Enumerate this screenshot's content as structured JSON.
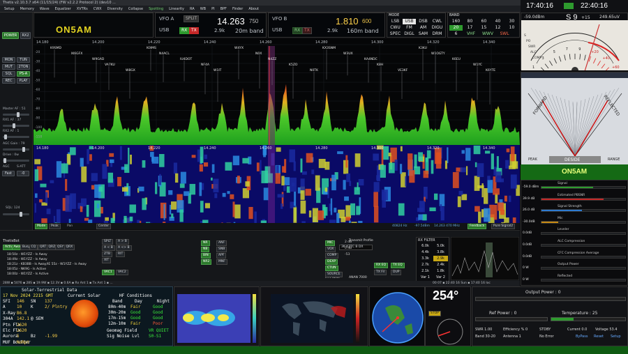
{
  "window": {
    "title": "Thetis v2.10.3.7 x64 (11/15/24) (FW v2.2.2 Protocol 2) (dev10 ...",
    "controls": [
      "—",
      "▢",
      "✕"
    ]
  },
  "menu": [
    "Setup",
    "Memory",
    "Wave",
    "Equalizer",
    "XVTRs",
    "CWX",
    "Diversity",
    "Collapse",
    "Spotting",
    "Linearity",
    "RA",
    "WB",
    "PI",
    "BPF",
    "Finder",
    "About"
  ],
  "menu_active": "Spotting",
  "left": {
    "power": "POWER",
    "rx2": "RX2",
    "buttons": [
      "MON",
      "TUN",
      "MUT",
      "2TON",
      "SQL",
      "PS-A",
      "REC",
      "PLAY"
    ],
    "labels": {
      "master_af": "Master AF : 51",
      "rx1_af": "RX1 AF : 37",
      "rx2_af": "RX2 AF : 1",
      "agc_gain": "AGC Gain : 79",
      "drive": "Drive : 0w",
      "agc": "AGC",
      "s_att": "S-ATT",
      "fast": "Fast",
      "att": "-0",
      "sql": "SQL: 124"
    }
  },
  "vfo": {
    "callsign": "ON5AM",
    "a": {
      "label": "VFO A",
      "split": "SPLIT",
      "mode": "USB",
      "rx": "RX",
      "tx": "TX",
      "bw": "2.9k",
      "freq_main": "14.263",
      "freq_sub": "750",
      "band": "20m band"
    },
    "b": {
      "label": "VFO B",
      "mode": "USB",
      "rx": "RX",
      "tx": "TX",
      "bw": "2.9k",
      "freq_main": "1.810",
      "freq_sub": "600",
      "band": "160m band"
    }
  },
  "mode": {
    "title": "MODE",
    "items": [
      "LSB",
      "USB",
      "DSB",
      "CWL",
      "CWU",
      "FM",
      "AM",
      "DIGU",
      "SPEC",
      "DIGL",
      "SAM",
      "DRM"
    ],
    "selected": "USB"
  },
  "band": {
    "title": "BAND",
    "items": [
      "160",
      "80",
      "60",
      "40",
      "30",
      "20",
      "17",
      "15",
      "12",
      "10",
      "6",
      "VHF",
      "WWV",
      "SWL"
    ],
    "selected": "20"
  },
  "clock": {
    "local": "17:40:16",
    "utc": "22:40:16"
  },
  "smeter": {
    "dbm": "-59.0dBm",
    "reading": "S 9",
    "plus": "+15",
    "uv": "249.65uV",
    "scale": [
      "1",
      "3",
      "5",
      "7",
      "9",
      "+20",
      "+40",
      "+60"
    ],
    "labels": [
      "S",
      "PO",
      "SWR",
      "ALC",
      "COMP"
    ]
  },
  "swrmeter": {
    "forward": "FORWARD",
    "reflected": "REFLECTED",
    "brand": "DESIDE",
    "peak": "PEAK",
    "range": "RANGE"
  },
  "right_call": "ON5AM",
  "meters": [
    {
      "label": "Signal",
      "value": "-59.0 dBm"
    },
    {
      "label": "Estimated PBSNR",
      "value": "39.9 dB"
    },
    {
      "label": "Signal Strength",
      "value": "26.0 dB"
    },
    {
      "label": "Mic",
      "value": "-30.0dB"
    },
    {
      "label": "Leveler",
      "value": "0.0dB"
    },
    {
      "label": "ALC Compression",
      "value": "0.0dB"
    },
    {
      "label": "CFC Compression Average",
      "value": "0.0dB"
    },
    {
      "label": "Output Power",
      "value": "0 W"
    },
    {
      "label": "Reflected",
      "value": "0 W"
    }
  ],
  "spectrum": {
    "freq_ticks": [
      "14.180",
      "14.200",
      "14.220",
      "14.240",
      "14.260",
      "14.280",
      "14.300",
      "14.320",
      "14.340"
    ],
    "spots": [
      "K9SMD",
      "IK6GFX",
      "W9GAD",
      "VA7KU",
      "W8GX",
      "K0IMS",
      "N4ACL",
      "IU4DOT",
      "NF4A",
      "W1IT",
      "W4YX",
      "N0X",
      "N4ZZ",
      "K5ZO",
      "N0TK",
      "KX3SNM",
      "W3UX",
      "KA4NDC",
      "K8H",
      "VE3KF",
      "K3KU",
      "W1OGTY",
      "K6EU",
      "W1YC",
      "K6YTE"
    ],
    "marker": "14.263",
    "db_ticks": [
      "-20",
      "-30",
      "-40",
      "-50",
      "-60",
      "-70",
      "-80",
      "-90",
      "-100",
      "-110",
      "-120"
    ]
  },
  "spec_status": {
    "mode": "Mode",
    "peak": "Peak",
    "pan": "Pan",
    "center": "Center",
    "hz": "40824 Hz",
    "dbm": "-97.5dBm",
    "freq": "14.263 470 MHz",
    "feedback": "Feedback",
    "pure_signal": "Pure Signal2"
  },
  "lower": {
    "thetis_title": "ThetisBot",
    "macros": [
      "Active",
      "Away",
      "Busy",
      "CQ",
      "QRT",
      "QRZ",
      "QSY",
      "QRX"
    ],
    "log": [
      "18:50z - W1YZZ - Is Away",
      "18:49z - W1YZZ - Is Away",
      "18:21z - KB3BB - Is Away/IE 55z - W1YZZ - Is Away",
      "18:05z - NK9G - Is Active",
      "18:00z - W1YZZ - Is Active"
    ],
    "split_buttons": [
      "SPLT",
      "A > B",
      "A < B",
      "A <> B",
      "ZTB",
      "RIT",
      "XIT"
    ],
    "vac": [
      "VAC1",
      "VAC2"
    ],
    "mic_buttons": [
      "MIC",
      "VOX",
      "COMP",
      "DEXP",
      "CTUN",
      "SOURCE"
    ],
    "dsp": [
      "NR",
      "ANF",
      "NB",
      "SNB",
      "BIN",
      "APF",
      "NR2",
      "MNF"
    ],
    "transmit_profile": "Transmit Profile",
    "tx_profile_value": "3K KZTC B DX",
    "eq": [
      "RX EQ",
      "TX EQ",
      "TX Fil",
      "DUP"
    ],
    "pa_profile": "PA Profile",
    "pa_value": "ANAN 7000",
    "mic_vals": [
      "2 dB",
      "0 dB",
      "-53"
    ],
    "rx_filter": {
      "title": "RX FILTER",
      "items": [
        "6.0k",
        "5.0k",
        "4.4k",
        "3.8k",
        "3.3k",
        "2.9k",
        "2.7k",
        "2.4k",
        "2.1k",
        "1.8k",
        "Var 1",
        "Var 2"
      ],
      "selected": "2.9k"
    }
  },
  "statusbar": [
    "28W ▪ 5076 ▪ 28S ▪ 19.9W ▪ 12.3V ▪ 0.6A ▪ Rx Ant 1 ▪ Tx Ant 1 ▪ ...",
    "00 07 ▪ 22:40 16 Sun ▪ 17:40 16 loc"
  ],
  "solar": {
    "title": "Solar-Terrestrial Data",
    "date": "17 Nov 2024 2215 GMT",
    "current": "Current Solar",
    "rows": [
      [
        "SFI",
        "146",
        "SN",
        "137"
      ],
      [
        "A",
        "10",
        "K",
        "2/ Plntry"
      ],
      [
        "X-Ray",
        "B6.8"
      ],
      [
        "304A",
        "142.1",
        "@ SEM"
      ],
      [
        "Ptn Flx",
        "2620"
      ],
      [
        "Elc Flx",
        "2620"
      ],
      [
        "Aurora",
        "5",
        "Bz",
        "-1.99"
      ],
      [
        "MUF Boulder",
        "NoRpt"
      ]
    ],
    "hf_title": "HF Conditions",
    "hf_head": [
      "Band",
      "Day",
      "Night"
    ],
    "hf": [
      [
        "80m-40m",
        "Fair",
        "Good"
      ],
      [
        "30m-20m",
        "Good",
        "Good"
      ],
      [
        "17m-15m",
        "Good",
        "Good"
      ],
      [
        "12m-10m",
        "Fair",
        "Poor"
      ]
    ],
    "geomag": [
      "Geomag Field",
      "VR QUIET"
    ],
    "noise": [
      "Sig Noise Lvl",
      "S0-S1"
    ]
  },
  "rotor": {
    "heading": "254°",
    "btn": "STOP"
  },
  "amp": {
    "output_power": "Output Power : 0",
    "ref_power": "Ref Power : 0",
    "temperature": "Temperature : 25",
    "swr": "SWR 1.00",
    "efficiency": "Efficiency % 0",
    "stdby": "STDBY",
    "current": "Current 0.0",
    "voltage": "Voltage 53.4",
    "band_lbl": "Band 30-20",
    "antenna": "Antenna 1",
    "no_error": "No Error",
    "bypass": "ByPass",
    "reset": "Reset",
    "setup": "Setup"
  },
  "colors": {
    "accent_green": "#2e9a2e",
    "callsign_yellow": "#e3d320",
    "vfo_b_yellow": "#ffd24a",
    "tx_red": "#c62828"
  }
}
